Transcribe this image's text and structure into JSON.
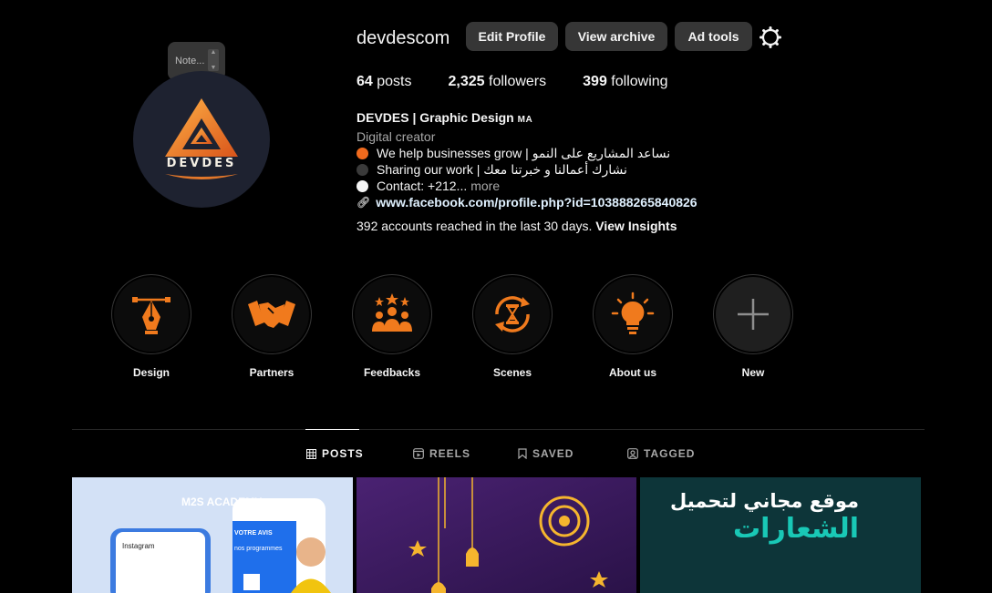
{
  "profile": {
    "avatar_text": "DEVDES",
    "note_placeholder": "Note...",
    "username": "devdescom",
    "buttons": {
      "edit": "Edit Profile",
      "archive": "View archive",
      "ad_tools": "Ad tools"
    }
  },
  "stats": {
    "posts_count": "64",
    "posts_label": "posts",
    "followers_count": "2,325",
    "followers_label": "followers",
    "following_count": "399",
    "following_label": "following"
  },
  "bio": {
    "name": "DEVDES | Graphic Design",
    "name_flag": "MA",
    "category": "Digital creator",
    "lines": [
      {
        "text": "We help businesses grow | نساعد المشاريع على النمو",
        "dot_color": "#f06a1d"
      },
      {
        "text": "Sharing our work | نشارك أعمالنا و خبرتنا معك",
        "dot_color": "#3a3a3a"
      },
      {
        "text": "Contact: +212...",
        "dot_color": "#f5f5f5"
      }
    ],
    "more": "more",
    "link": "www.facebook.com/profile.php?id=103888265840826"
  },
  "insights": {
    "text": "392 accounts reached in the last 30 days.",
    "action": "View Insights"
  },
  "highlights": [
    {
      "label": "Design",
      "icon": "pen-tool-icon"
    },
    {
      "label": "Partners",
      "icon": "handshake-icon"
    },
    {
      "label": "Feedbacks",
      "icon": "people-stars-icon"
    },
    {
      "label": "Scenes",
      "icon": "hourglass-refresh-icon"
    },
    {
      "label": "About us",
      "icon": "lightbulb-icon"
    },
    {
      "label": "New",
      "icon": "plus-icon"
    }
  ],
  "tabs": [
    {
      "label": "POSTS",
      "icon": "grid-icon",
      "active": true
    },
    {
      "label": "REELS",
      "icon": "reels-icon",
      "active": false
    },
    {
      "label": "SAVED",
      "icon": "bookmark-icon",
      "active": false
    },
    {
      "label": "TAGGED",
      "icon": "tag-icon",
      "active": false
    }
  ],
  "posts": {
    "post1": {
      "badge": "M2S ACADEMY",
      "headline": "VOTRE AVIS",
      "subline": "nos programmes",
      "app": "Instagram"
    },
    "post2": {},
    "post3": {
      "line1": "موقع مجاني لتحميل",
      "line2": "الشعارات"
    }
  },
  "colors": {
    "accent_orange": "#f07a1d",
    "background": "#000000",
    "button": "#363636",
    "muted": "#a8a8a8"
  }
}
